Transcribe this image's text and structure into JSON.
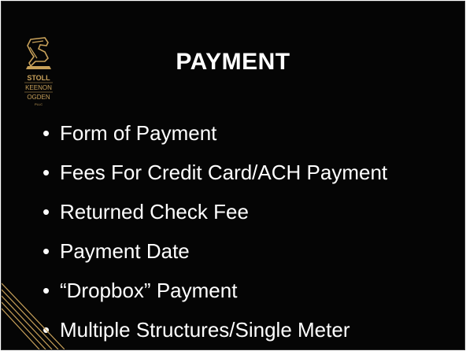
{
  "slide": {
    "title": "PAYMENT",
    "bullets": [
      "Form of Payment",
      "Fees For Credit Card/ACH Payment",
      "Returned Check Fee",
      "Payment Date",
      "“Dropbox” Payment",
      "Multiple Structures/Single Meter"
    ],
    "bullet_glyph": "•"
  },
  "logo": {
    "line1": "STOLL",
    "line2": "KEENON",
    "line3": "OGDEN",
    "line4": "PLLC",
    "color": "#c8a15a"
  },
  "colors": {
    "background": "#050505",
    "text": "#ffffff",
    "accent_gold": "#c8a15a"
  }
}
